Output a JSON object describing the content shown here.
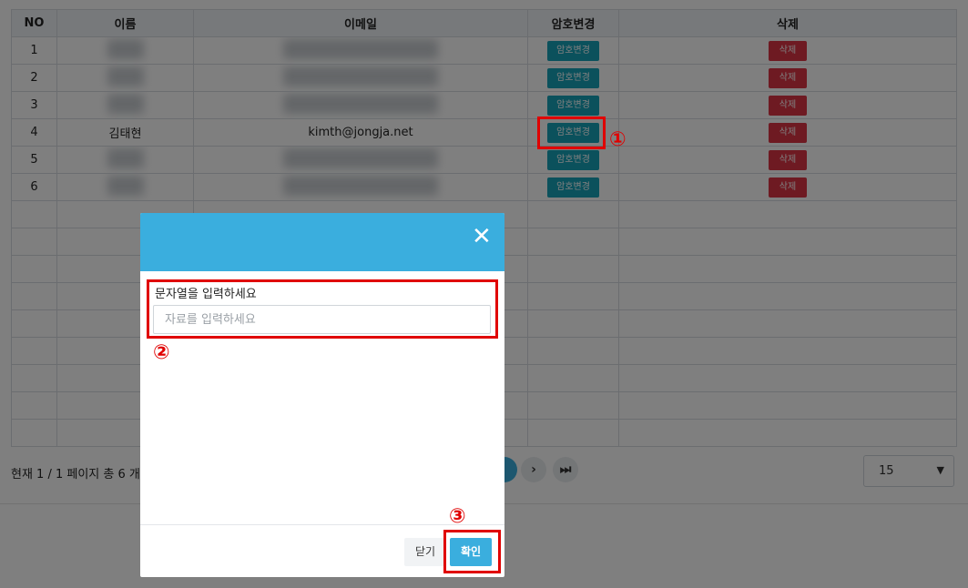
{
  "table": {
    "headers": [
      "NO",
      "이름",
      "이메일",
      "암호변경",
      "삭제"
    ],
    "rows": [
      {
        "no": "1",
        "name": "",
        "email": "",
        "pw_btn": "암호변경",
        "del_btn": "삭제"
      },
      {
        "no": "2",
        "name": "",
        "email": "",
        "pw_btn": "암호변경",
        "del_btn": "삭제"
      },
      {
        "no": "3",
        "name": "",
        "email": "",
        "pw_btn": "암호변경",
        "del_btn": "삭제"
      },
      {
        "no": "4",
        "name": "김태현",
        "email": "kimth@jongja.net",
        "pw_btn": "암호변경",
        "del_btn": "삭제"
      },
      {
        "no": "5",
        "name": "",
        "email": "",
        "pw_btn": "암호변경",
        "del_btn": "삭제"
      },
      {
        "no": "6",
        "name": "",
        "email": "",
        "pw_btn": "암호변경",
        "del_btn": "삭제"
      }
    ]
  },
  "pager": {
    "info": "현재 1 / 1 페이지 총 6 개",
    "next_icon": "chevron-right-icon",
    "last_icon": "skip-last-icon",
    "page_size": "15"
  },
  "modal": {
    "close_icon": "close-icon",
    "field_label": "문자열을 입력하세요",
    "field_placeholder": "자료를 입력하세요",
    "field_value": "",
    "close_label": "닫기",
    "ok_label": "확인"
  },
  "annotations": [
    "①",
    "②",
    "③"
  ],
  "colors": {
    "header_bg": "#3aaede",
    "pw_button": "#17a2b8",
    "delete_button": "#dc3545",
    "annotation": "#e00000"
  }
}
